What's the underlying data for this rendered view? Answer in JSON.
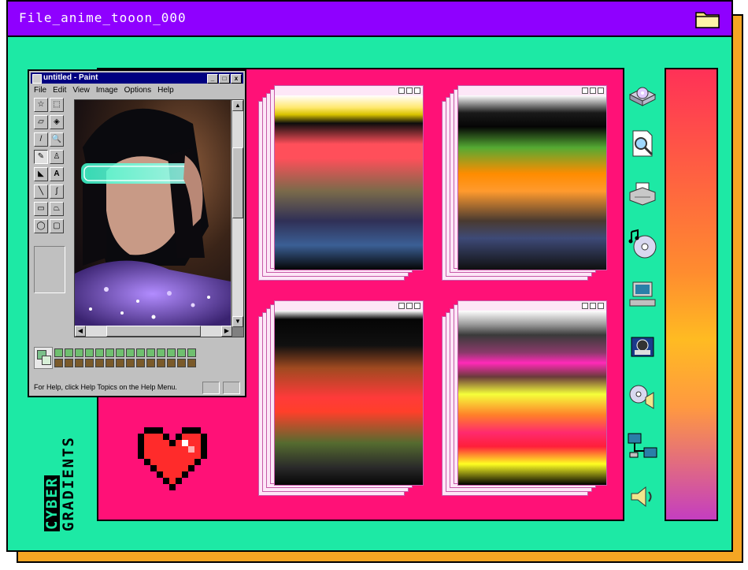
{
  "window": {
    "title": "File_anime_tooon_000",
    "folder_icon": "folder-icon"
  },
  "paint": {
    "title": "untitled - Paint",
    "menu": [
      "File",
      "Edit",
      "View",
      "Image",
      "Options",
      "Help"
    ],
    "status": "For Help, click Help Topics on the Help Menu.",
    "title_buttons": [
      "_",
      "□",
      "x"
    ],
    "tool_A_label": "A"
  },
  "branding": {
    "line1": "CYBER",
    "line2": "GRADIENTS"
  },
  "colors": {
    "main_bg": "#1de9a5",
    "title_bar": "#8f00ff",
    "pink_panel": "#ff1177",
    "shadow": "#f5a623",
    "heart": "#ff2b2b"
  },
  "gradient_windows": [
    {
      "name": "gradient-window-1"
    },
    {
      "name": "gradient-window-2"
    },
    {
      "name": "gradient-window-3"
    },
    {
      "name": "gradient-window-4"
    }
  ],
  "sidebar_icons": [
    "drive-icon",
    "search-document-icon",
    "printer-icon",
    "music-cd-icon",
    "computer-icon",
    "camera-icon",
    "cd-speaker-icon",
    "network-icon",
    "speaker-icon"
  ]
}
